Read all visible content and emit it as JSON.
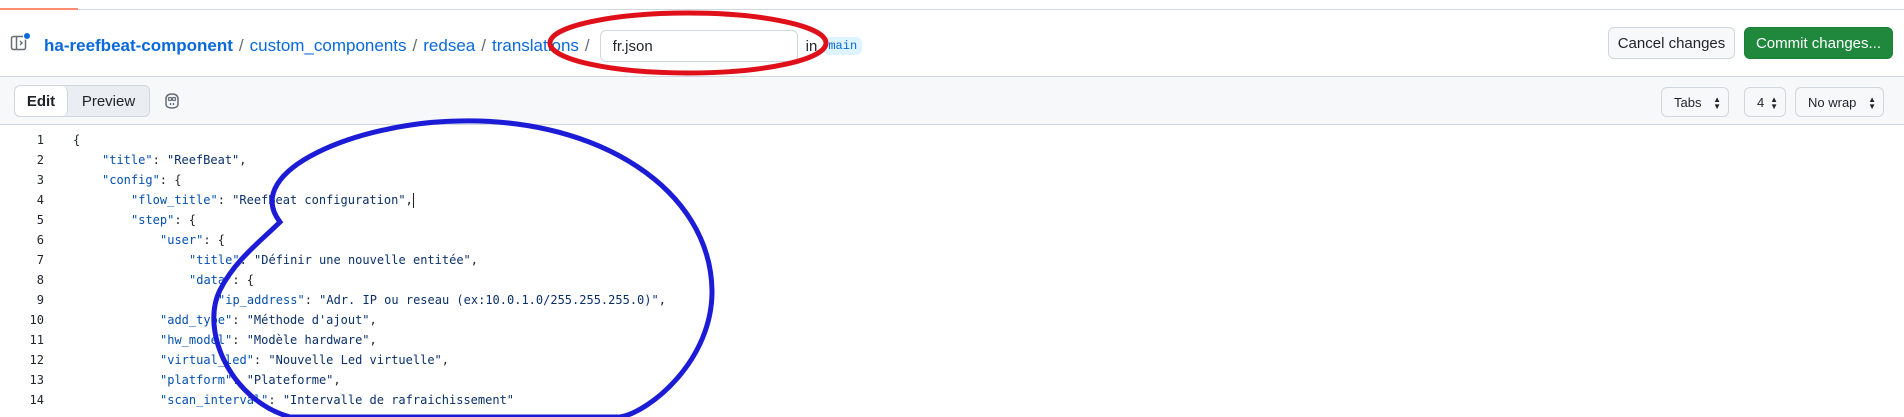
{
  "header": {
    "repo": "ha-reefbeat-component",
    "path": [
      "custom_components",
      "redsea",
      "translations"
    ],
    "separator": "/",
    "filename": "fr.json",
    "in_label": "in",
    "branch": "main",
    "cancel_label": "Cancel changes",
    "commit_label": "Commit changes..."
  },
  "toolbar": {
    "edit_label": "Edit",
    "preview_label": "Preview",
    "indent_mode": "Tabs",
    "indent_size": "4",
    "wrap_mode": "No wrap"
  },
  "code_lines": [
    {
      "n": "1",
      "indent": 0,
      "parts": [
        [
          "p",
          "{"
        ]
      ]
    },
    {
      "n": "2",
      "indent": 1,
      "parts": [
        [
          "k",
          "\"title\""
        ],
        [
          "p",
          ": "
        ],
        [
          "s",
          "\"ReefBeat\""
        ],
        [
          "p",
          ","
        ]
      ]
    },
    {
      "n": "3",
      "indent": 1,
      "parts": [
        [
          "k",
          "\"config\""
        ],
        [
          "p",
          ": {"
        ]
      ]
    },
    {
      "n": "4",
      "indent": 2,
      "parts": [
        [
          "k",
          "\"flow_title\""
        ],
        [
          "p",
          ": "
        ],
        [
          "s",
          "\"ReefBeat configuration\""
        ],
        [
          "p",
          ","
        ]
      ],
      "caret": true
    },
    {
      "n": "5",
      "indent": 2,
      "parts": [
        [
          "k",
          "\"step\""
        ],
        [
          "p",
          ": {"
        ]
      ]
    },
    {
      "n": "6",
      "indent": 3,
      "parts": [
        [
          "k",
          "\"user\""
        ],
        [
          "p",
          ": {"
        ]
      ]
    },
    {
      "n": "7",
      "indent": 4,
      "parts": [
        [
          "k",
          "\"title\""
        ],
        [
          "p",
          ": "
        ],
        [
          "s",
          "\"Définir une nouvelle entitée\""
        ],
        [
          "p",
          ","
        ]
      ]
    },
    {
      "n": "8",
      "indent": 4,
      "parts": [
        [
          "k",
          "\"data\""
        ],
        [
          "p",
          ": {"
        ]
      ]
    },
    {
      "n": "9",
      "indent": 5,
      "parts": [
        [
          "k",
          "\"ip_address\""
        ],
        [
          "p",
          ": "
        ],
        [
          "s",
          "\"Adr. IP ou reseau (ex:10.0.1.0/255.255.255.0)\""
        ],
        [
          "p",
          ","
        ]
      ]
    },
    {
      "n": "10",
      "indent": 3,
      "parts": [
        [
          "k",
          "\"add_type\""
        ],
        [
          "p",
          ": "
        ],
        [
          "s",
          "\"Méthode d'ajout\""
        ],
        [
          "p",
          ","
        ]
      ]
    },
    {
      "n": "11",
      "indent": 3,
      "parts": [
        [
          "k",
          "\"hw_model\""
        ],
        [
          "p",
          ": "
        ],
        [
          "s",
          "\"Modèle hardware\""
        ],
        [
          "p",
          ","
        ]
      ]
    },
    {
      "n": "12",
      "indent": 3,
      "parts": [
        [
          "k",
          "\"virtual_led\""
        ],
        [
          "p",
          ": "
        ],
        [
          "s",
          "\"Nouvelle Led virtuelle\""
        ],
        [
          "p",
          ","
        ]
      ]
    },
    {
      "n": "13",
      "indent": 3,
      "parts": [
        [
          "k",
          "\"platform\""
        ],
        [
          "p",
          ": "
        ],
        [
          "s",
          "\"Plateforme\""
        ],
        [
          "p",
          ","
        ]
      ]
    },
    {
      "n": "14",
      "indent": 3,
      "parts": [
        [
          "k",
          "\"scan_interval\""
        ],
        [
          "p",
          ": "
        ],
        [
          "s",
          "\"Intervalle de rafraichissement\""
        ]
      ]
    }
  ],
  "colors": {
    "accent_blue": "#0969da",
    "commit_green": "#1f883d",
    "annotation_red": "#e0101a",
    "annotation_blue": "#1c1cd6"
  },
  "icons": [
    "sidebar-toggle-icon",
    "copilot-icon",
    "select-arrows-icon"
  ]
}
